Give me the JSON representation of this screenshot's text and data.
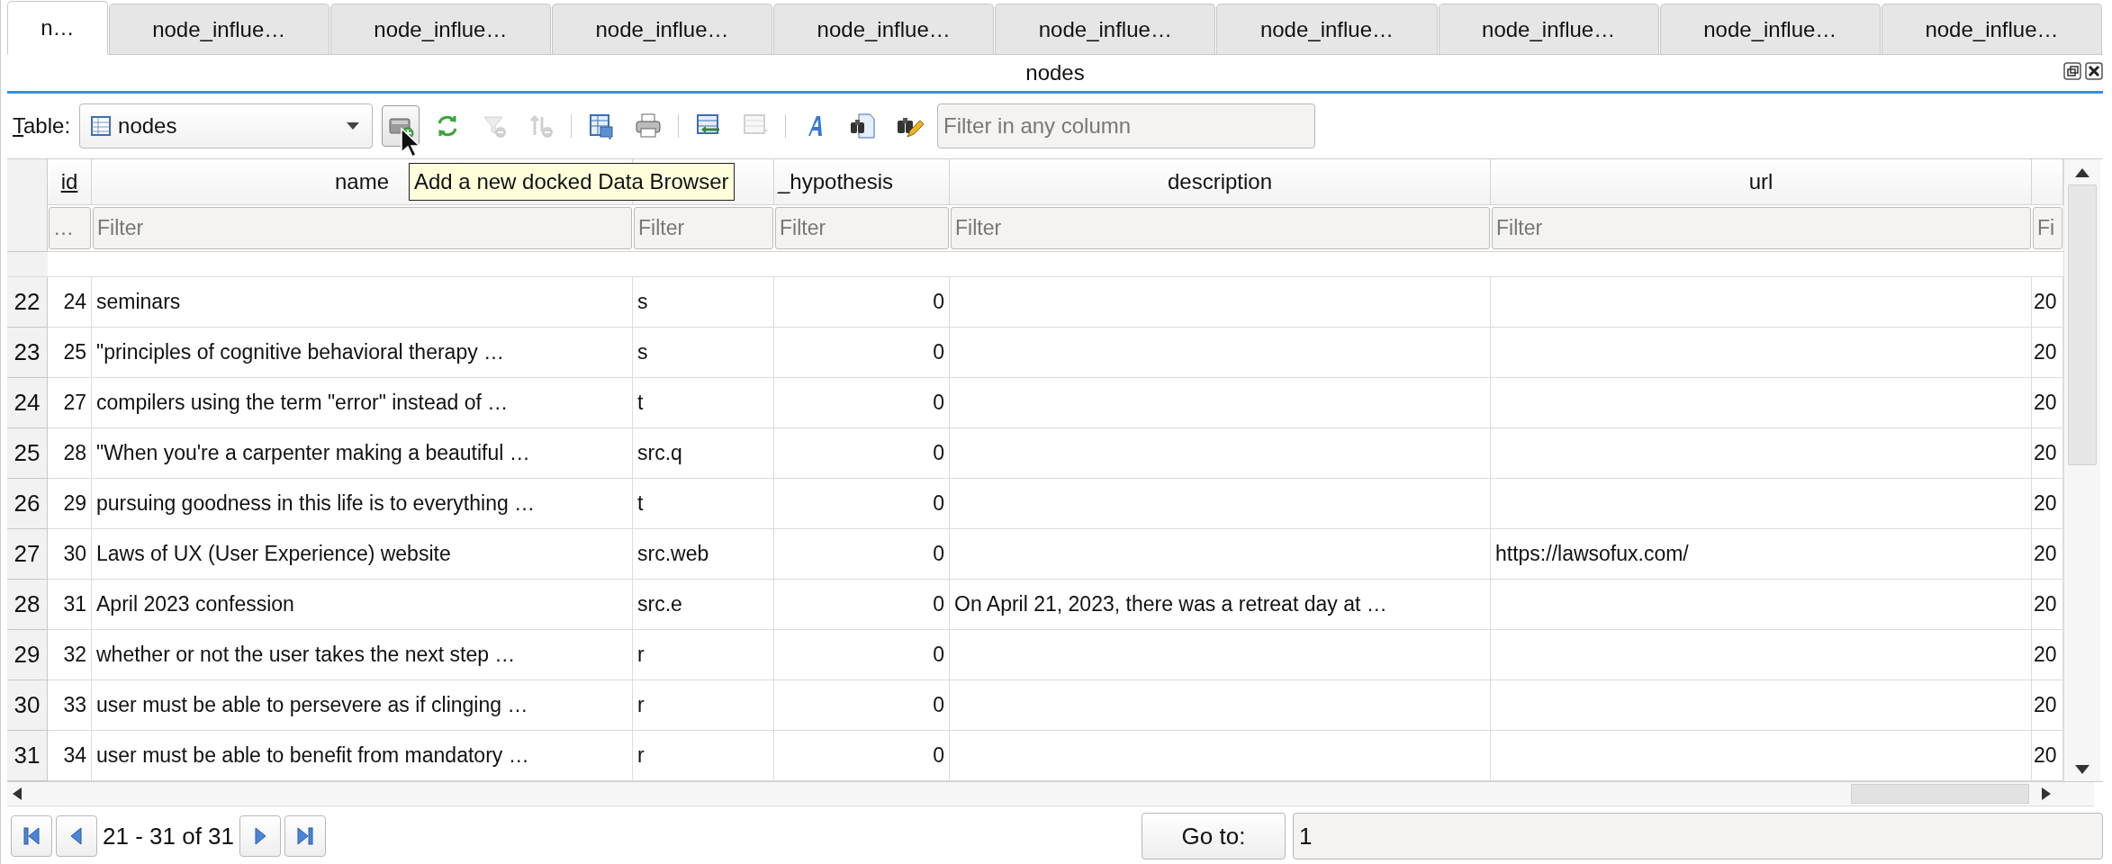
{
  "tabs": [
    {
      "label": "n…",
      "selected": true
    },
    {
      "label": "node_influe…",
      "selected": false
    },
    {
      "label": "node_influe…",
      "selected": false
    },
    {
      "label": "node_influe…",
      "selected": false
    },
    {
      "label": "node_influe…",
      "selected": false
    },
    {
      "label": "node_influe…",
      "selected": false
    },
    {
      "label": "node_influe…",
      "selected": false
    },
    {
      "label": "node_influe…",
      "selected": false
    },
    {
      "label": "node_influe…",
      "selected": false
    },
    {
      "label": "node_influe…",
      "selected": false
    }
  ],
  "dock": {
    "title": "nodes"
  },
  "toolbar": {
    "table_label": "Table:",
    "table_value": "nodes",
    "filter_placeholder": "Filter in any column",
    "buttons": [
      {
        "kind": "add-browser",
        "hovered": true,
        "disabled": false
      },
      {
        "kind": "refresh",
        "hovered": false,
        "disabled": false
      },
      {
        "kind": "clear-filters",
        "hovered": false,
        "disabled": true
      },
      {
        "kind": "sort",
        "hovered": false,
        "disabled": true
      },
      {
        "kind": "save",
        "hovered": false,
        "disabled": false
      },
      {
        "kind": "print",
        "hovered": false,
        "disabled": false
      },
      {
        "kind": "insert-record",
        "hovered": false,
        "disabled": false
      },
      {
        "kind": "delete-record",
        "hovered": false,
        "disabled": true
      },
      {
        "kind": "font",
        "hovered": false,
        "disabled": false
      },
      {
        "kind": "find",
        "hovered": false,
        "disabled": false
      },
      {
        "kind": "edit",
        "hovered": false,
        "disabled": false
      }
    ]
  },
  "tooltip": "Add a new docked Data Browser",
  "table": {
    "columns": [
      {
        "label": "id",
        "primary_key": true
      },
      {
        "label": "name",
        "primary_key": false
      },
      {},
      {
        "label": "_hypothesis",
        "primary_key": false
      },
      {
        "label": "description",
        "primary_key": false
      },
      {
        "label": "url",
        "primary_key": false
      },
      {}
    ],
    "filters": [
      {
        "placeholder": "…"
      },
      {
        "placeholder": "Filter"
      },
      {
        "placeholder": "Filter"
      },
      {
        "placeholder": "Filter"
      },
      {
        "placeholder": "Filter"
      },
      {
        "placeholder": "Filter"
      },
      {
        "placeholder": "Fi"
      }
    ],
    "rows": [
      {
        "row_header": "22",
        "id": "24",
        "name": "seminars",
        "column_3": "s",
        "hypothesis": "0",
        "column_7": "20"
      },
      {
        "row_header": "23",
        "id": "25",
        "name": "\"principles of cognitive behavioral therapy …",
        "column_3": "s",
        "hypothesis": "0",
        "column_7": "20"
      },
      {
        "row_header": "24",
        "id": "27",
        "name": "compilers using the term \"error\" instead of …",
        "column_3": "t",
        "hypothesis": "0",
        "column_7": "20"
      },
      {
        "row_header": "25",
        "id": "28",
        "name": "\"When you're a carpenter making a beautiful …",
        "column_3": "src.q",
        "hypothesis": "0",
        "column_7": "20"
      },
      {
        "row_header": "26",
        "id": "29",
        "name": "pursuing goodness in this life is to everything …",
        "column_3": "t",
        "hypothesis": "0",
        "column_7": "20"
      },
      {
        "row_header": "27",
        "id": "30",
        "name": "Laws of UX (User Experience) website",
        "column_3": "src.web",
        "hypothesis": "0",
        "url": "https://lawsofux.com/",
        "column_7": "20"
      },
      {
        "row_header": "28",
        "id": "31",
        "name": "April 2023 confession",
        "column_3": "src.e",
        "hypothesis": "0",
        "description": "On April 21, 2023, there was a retreat day at …",
        "column_7": "20"
      },
      {
        "row_header": "29",
        "id": "32",
        "name": "whether or not the user takes the next step …",
        "column_3": "r",
        "hypothesis": "0",
        "column_7": "20"
      },
      {
        "row_header": "30",
        "id": "33",
        "name": "user must be able to persevere as if clinging …",
        "column_3": "r",
        "hypothesis": "0",
        "column_7": "20"
      },
      {
        "row_header": "31",
        "id": "34",
        "name": "user must be able to benefit from mandatory …",
        "column_3": "r",
        "hypothesis": "0",
        "column_7": "20"
      }
    ]
  },
  "pager": {
    "range": "21 - 31 of 31",
    "goto_label": "Go to:",
    "goto_value": "1"
  }
}
